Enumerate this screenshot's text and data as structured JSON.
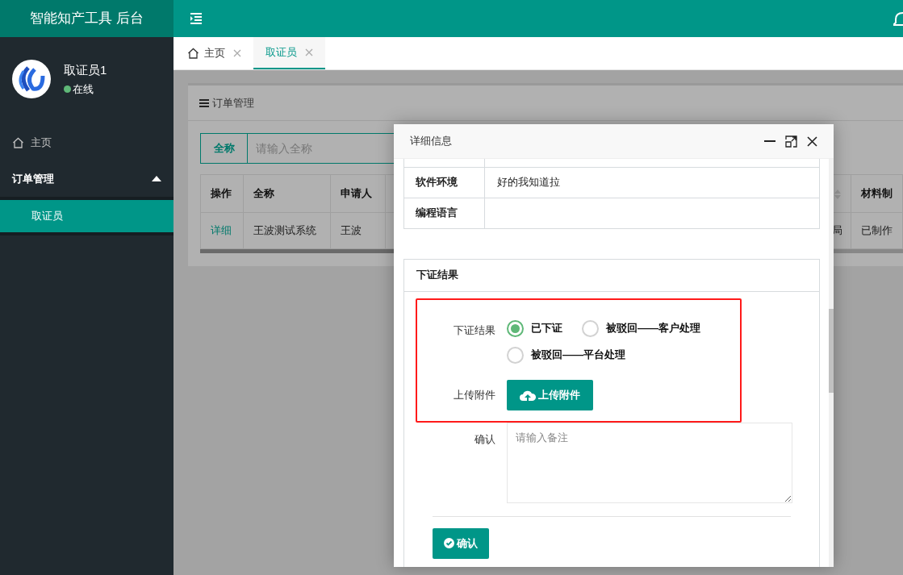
{
  "app_title": "智能知产工具 后台",
  "sidebar": {
    "user": {
      "name": "取证员1",
      "status": "在线",
      "online": true
    },
    "items": [
      {
        "label": "主页",
        "kind": "link"
      },
      {
        "label": "订单管理",
        "kind": "group",
        "expanded": true,
        "children": [
          {
            "label": "取证员",
            "selected": true
          }
        ]
      }
    ]
  },
  "tabs": [
    {
      "label": "主页",
      "home": true,
      "selected": false
    },
    {
      "label": "取证员",
      "home": false,
      "selected": true
    }
  ],
  "panel": {
    "title": "订单管理",
    "search": {
      "label": "全称",
      "placeholder": "请输入全称"
    },
    "table": {
      "columns": [
        {
          "label": "操作"
        },
        {
          "label": "全称"
        },
        {
          "label": "申请人"
        },
        {
          "sortable": true
        },
        {
          "label": "材料制"
        }
      ],
      "rows": [
        [
          "详细",
          "王波测试系统",
          "王波",
          "局",
          "已制作"
        ]
      ]
    }
  },
  "dialog": {
    "title": "详细信息",
    "details": [
      {
        "label": "软件环境",
        "value": "好的我知道拉"
      },
      {
        "label": "编程语言"
      }
    ],
    "result": {
      "title": "下证结果",
      "field_label": "下证结果",
      "options": [
        {
          "label": "已下证",
          "selected": true
        },
        {
          "label": "被驳回——客户处理",
          "selected": false
        },
        {
          "label": "被驳回——平台处理",
          "selected": false
        }
      ],
      "upload_label": "上传附件",
      "upload_button": "上传附件",
      "remark_label": "确认",
      "remark_placeholder": "请输入备注",
      "submit": "确认"
    }
  }
}
